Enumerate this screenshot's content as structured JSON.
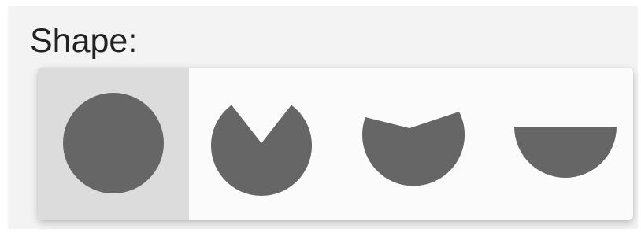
{
  "title": "Shape:",
  "picker": {
    "selected_index": 0,
    "options": [
      {
        "name": "full-circle",
        "icon": "full-circle-icon"
      },
      {
        "name": "pie-notch",
        "icon": "pie-notch-icon"
      },
      {
        "name": "wide-notch",
        "icon": "wide-notch-icon"
      },
      {
        "name": "half-circle",
        "icon": "half-circle-icon"
      }
    ]
  },
  "colors": {
    "shape_fill": "#666666",
    "selected_bg": "#dcdcdc",
    "picker_bg": "#fbfbfb",
    "panel_bg": "#f3f3f3",
    "title_text": "#222222"
  }
}
